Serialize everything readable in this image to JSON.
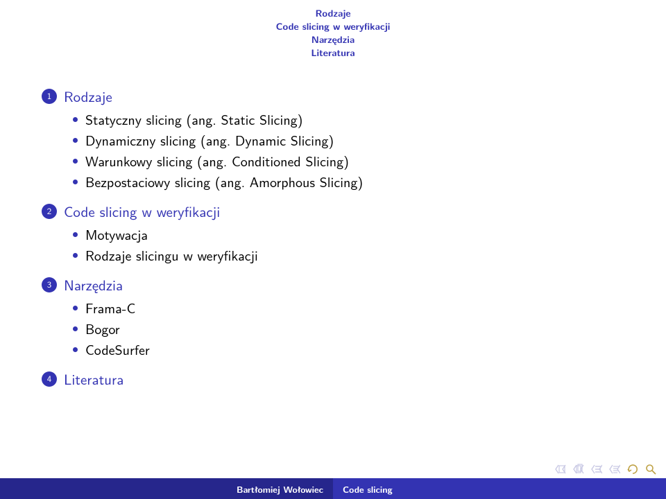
{
  "header": {
    "lines": [
      {
        "text": "Rodzaje",
        "active": true
      },
      {
        "text": "Code slicing w weryfikacji",
        "active": true
      },
      {
        "text": "Narzędzia",
        "active": true
      },
      {
        "text": "Literatura",
        "active": true
      }
    ]
  },
  "outline": [
    {
      "num": "1",
      "title": "Rodzaje",
      "items": [
        "Statyczny slicing (ang. Static Slicing)",
        "Dynamiczny slicing (ang. Dynamic Slicing)",
        "Warunkowy slicing (ang. Conditioned Slicing)",
        "Bezpostaciowy slicing (ang. Amorphous Slicing)"
      ]
    },
    {
      "num": "2",
      "title": "Code slicing w weryfikacji",
      "items": [
        "Motywacja",
        "Rodzaje slicingu w weryfikacji"
      ]
    },
    {
      "num": "3",
      "title": "Narzędzia",
      "items": [
        "Frama-C",
        "Bogor",
        "CodeSurfer"
      ]
    },
    {
      "num": "4",
      "title": "Literatura",
      "items": []
    }
  ],
  "footer": {
    "author": "Bartłomiej Wołowiec",
    "title": "Code slicing"
  }
}
